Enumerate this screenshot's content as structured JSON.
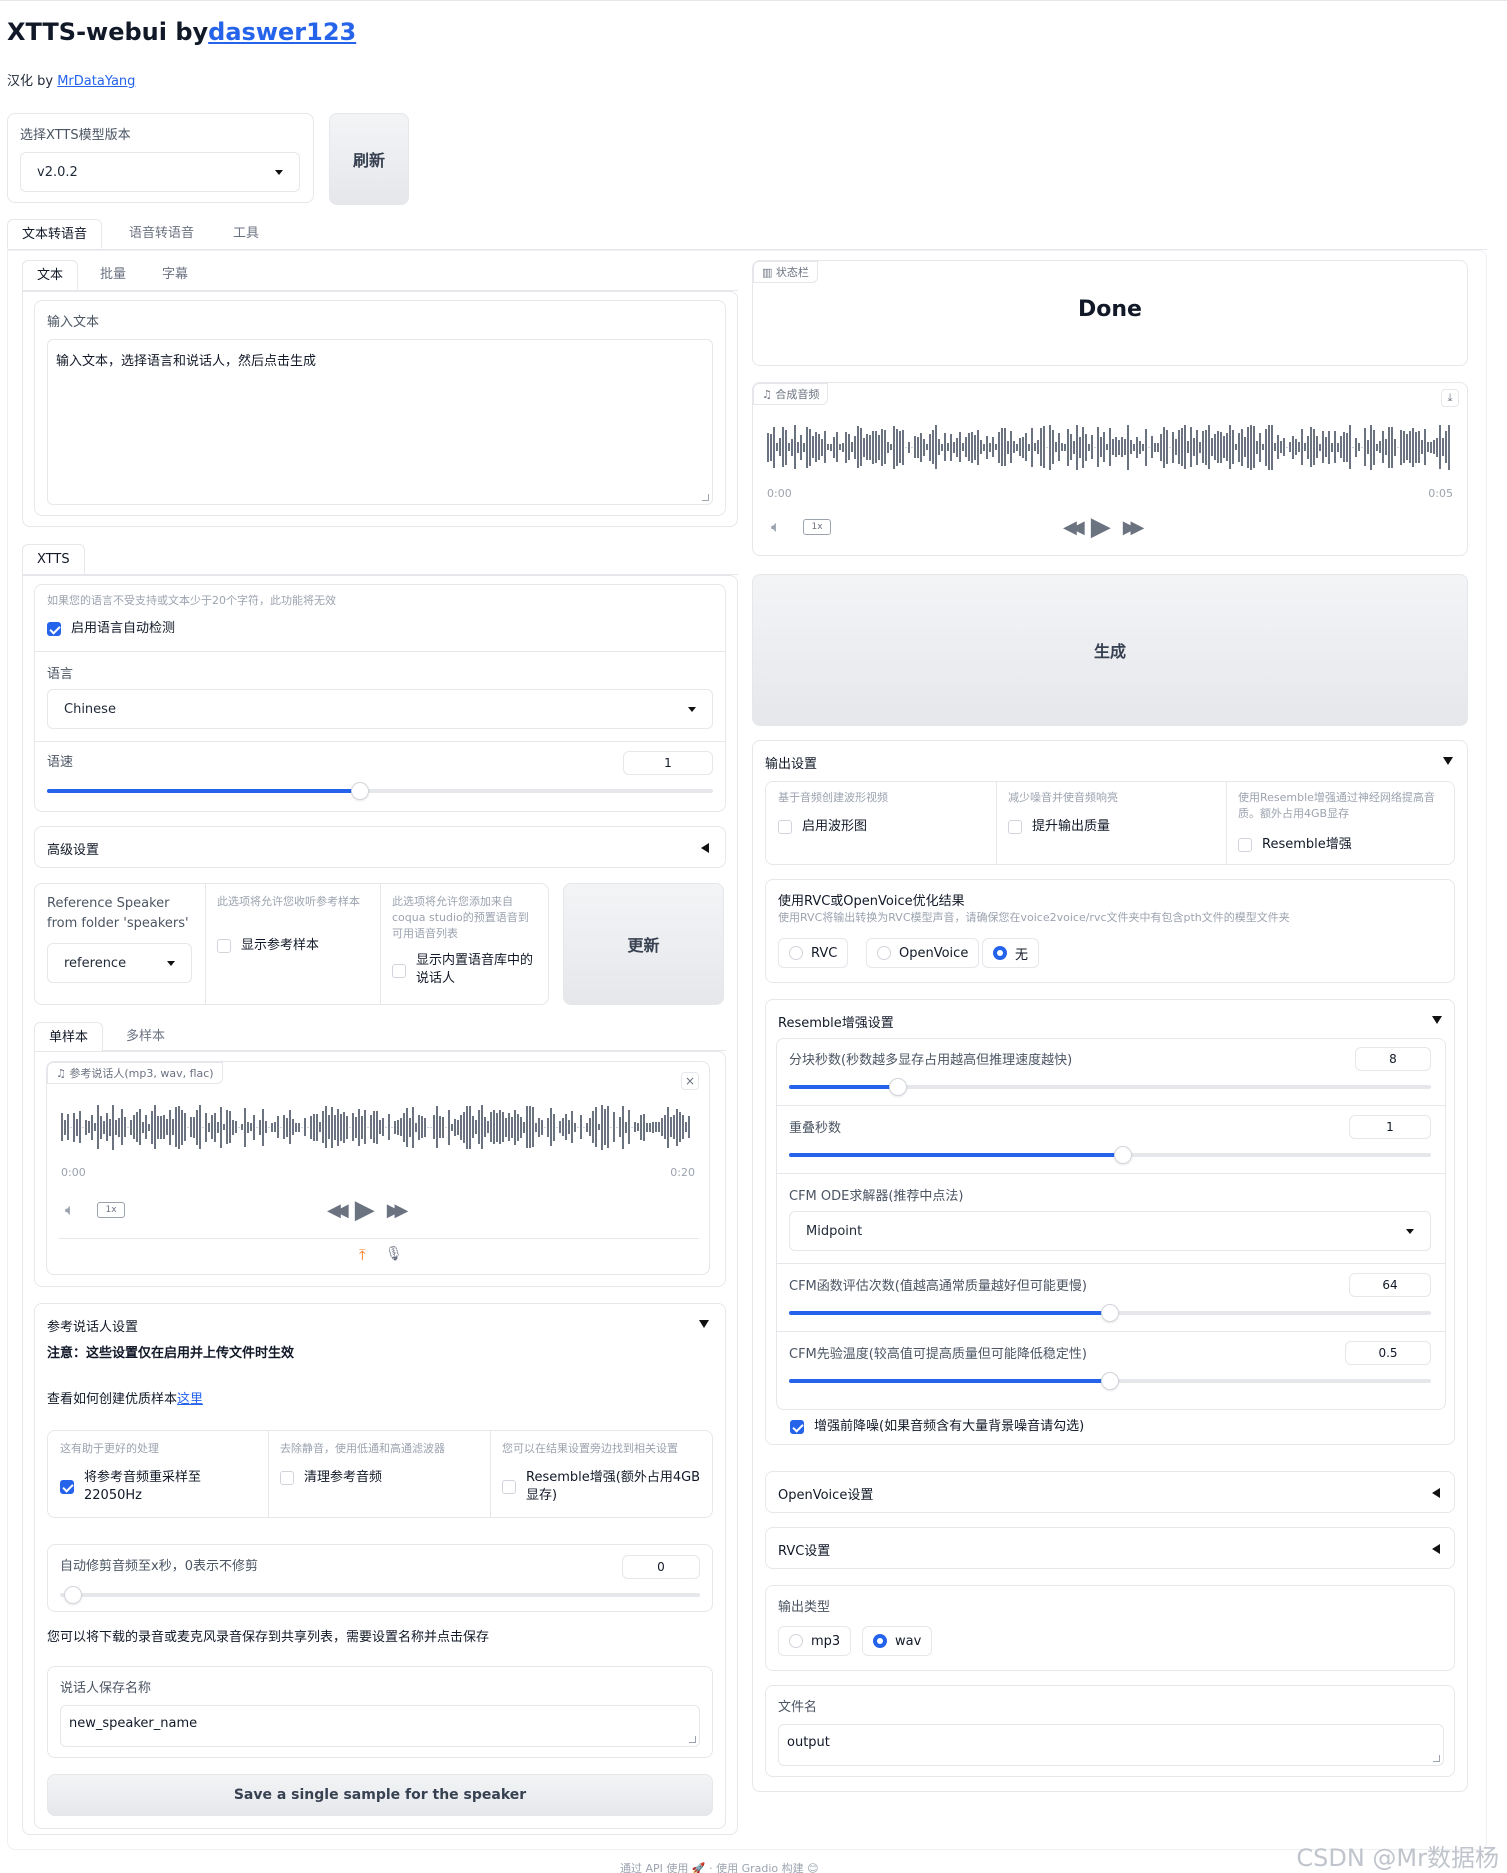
{
  "header": {
    "title_prefix": "XTTS-webui by",
    "title_link": "daswer123",
    "sub_prefix": "汉化 by ",
    "sub_link": "MrDataYang"
  },
  "model": {
    "label": "选择XTTS模型版本",
    "value": "v2.0.2",
    "refresh_label": "刷新"
  },
  "main_tabs": [
    "文本转语音",
    "语音转语音",
    "工具"
  ],
  "input_tabs": [
    "文本",
    "批量",
    "字幕"
  ],
  "text_input": {
    "label": "输入文本",
    "value": "输入文本，选择语言和说话人，然后点击生成"
  },
  "xtts_tab": "XTTS",
  "lang_detect": {
    "hint": "如果您的语言不受支持或文本少于20个字符，此功能将无效",
    "label": "启用语言自动检测",
    "checked": true
  },
  "language": {
    "label": "语言",
    "value": "Chinese"
  },
  "speed": {
    "label": "语速",
    "value": "1",
    "fraction": 0.47
  },
  "advanced": {
    "label": "高级设置"
  },
  "reference": {
    "label": "Reference Speaker from folder 'speakers'",
    "value": "reference",
    "show_ref_hint": "此选项将允许您收听参考样本",
    "show_ref_label": "显示参考样本",
    "builtin_hint": "此选项将允许您添加来自coqua studio的预置语音到可用语音列表",
    "builtin_label": "显示内置语音库中的说话人",
    "update_label": "更新"
  },
  "sample_tabs": [
    "单样本",
    "多样本"
  ],
  "ref_audio": {
    "badge": "参考说话人(mp3, wav, flac)",
    "start": "0:00",
    "end": "0:20",
    "speed": "1x"
  },
  "ref_settings": {
    "title": "参考说话人设置",
    "note": "注意：这些设置仅在启用并上传文件时生效",
    "howto_prefix": "查看如何创建优质样本",
    "howto_link": "这里",
    "c1_hint": "这有助于更好的处理",
    "c1_label": "将参考音频重采样至22050Hz",
    "c2_hint": "去除静音，使用低通和高通滤波器",
    "c2_label": "清理参考音频",
    "c3_hint": "您可以在结果设置旁边找到相关设置",
    "c3_label": "Resemble增强(额外占用4GB显存)",
    "trim_label": "自动修剪音频至x秒，0表示不修剪",
    "trim_value": "0",
    "save_note": "您可以将下载的录音或麦克风录音保存到共享列表，需要设置名称并点击保存",
    "name_label": "说话人保存名称",
    "name_value": "new_speaker_name",
    "save_button": "Save a single sample for the speaker"
  },
  "status": {
    "badge": "状态栏",
    "text": "Done"
  },
  "output_audio": {
    "badge": "合成音频",
    "start": "0:00",
    "end": "0:05",
    "speed": "1x"
  },
  "generate_label": "生成",
  "output_settings": {
    "title": "输出设置",
    "c1_hint": "基于音频创建波形视频",
    "c1_label": "启用波形图",
    "c2_hint": "减少噪音并使音频响亮",
    "c2_label": "提升输出质量",
    "c3_hint": "使用Resemble增强通过神经网络提高音质。额外占用4GB显存",
    "c3_label": "Resemble增强",
    "rvc_title": "使用RVC或OpenVoice优化结果",
    "rvc_hint": "使用RVC将输出转换为RVC模型声音，请确保您在voice2voice/rvc文件夹中有包含pth文件的模型文件夹",
    "rvc_options": [
      "RVC",
      "OpenVoice",
      "无"
    ],
    "rvc_selected": "无"
  },
  "resemble": {
    "title": "Resemble增强设置",
    "chunk_label": "分块秒数(秒数越多显存占用越高但推理速度越快)",
    "chunk_value": "8",
    "overlap_label": "重叠秒数",
    "overlap_value": "1",
    "solver_label": "CFM ODE求解器(推荐中点法)",
    "solver_value": "Midpoint",
    "nfe_label": "CFM函数评估次数(值越高通常质量越好但可能更慢)",
    "nfe_value": "64",
    "temp_label": "CFM先验温度(较高值可提高质量但可能降低稳定性)",
    "temp_value": "0.5",
    "denoise_label": "增强前降噪(如果音频含有大量背景噪音请勾选)"
  },
  "openvoice_settings": "OpenVoice设置",
  "rvc_settings": "RVC设置",
  "output_type": {
    "label": "输出类型",
    "options": [
      "mp3",
      "wav"
    ],
    "selected": "wav"
  },
  "filename": {
    "label": "文件名",
    "value": "output"
  },
  "footer": "通过 API 使用 🚀 · 使用 Gradio 构建 😊",
  "watermark": "CSDN @Mr数据杨",
  "colors": {
    "accent": "#2563eb",
    "border": "#e5e7eb"
  }
}
